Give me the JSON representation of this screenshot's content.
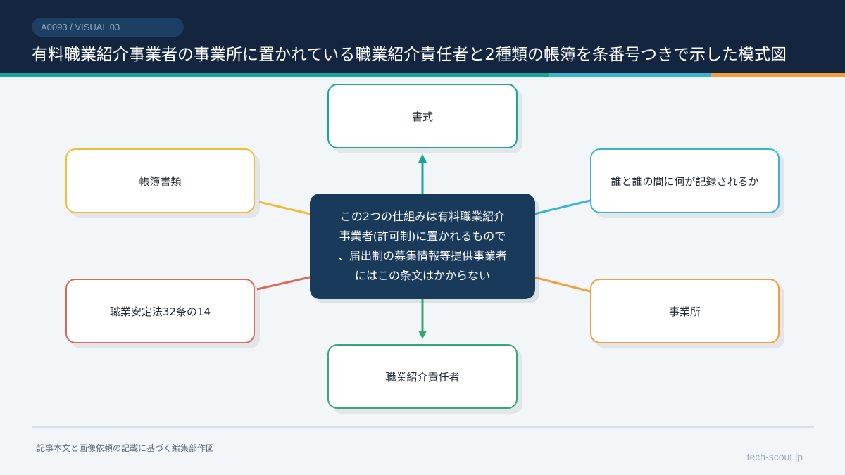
{
  "header": {
    "tag": "A0093 / VISUAL 03",
    "title": "有料職業紹介事業者の事業所に置かれている職業紹介責任者と2種類の帳簿を条番号つきで示した模式図"
  },
  "diagram": {
    "center": {
      "lines": [
        "この2つの仕組みは有料職業紹介",
        "事業者(許可制)に置かれるもので",
        "、届出制の募集情報等提供事業者",
        "にはこの条文はかからない"
      ]
    },
    "nodes": {
      "top": {
        "label": "書式",
        "color": "#1aa59a"
      },
      "left_upper": {
        "label": "帳簿書類",
        "color": "#efbd3a"
      },
      "right_upper": {
        "label": "誰と誰の間に何が記録されるか",
        "color": "#39b5cf"
      },
      "left_lower": {
        "label": "職業安定法32条の14",
        "color": "#dc6a55"
      },
      "right_lower": {
        "label": "事業所",
        "color": "#f29e3d"
      },
      "bottom": {
        "label": "職業紹介責任者",
        "color": "#37a871"
      }
    }
  },
  "colors": {
    "header_bg": "#13253f",
    "center_bg": "#1a3a5c",
    "stripe_teal": "#1aa59a",
    "stripe_cyan": "#39b5cf",
    "stripe_orange": "#f29e3d"
  },
  "footer": {
    "note": "記事本文と画像依頼の記載に基づく編集部作図",
    "site": "tech-scout.jp"
  }
}
